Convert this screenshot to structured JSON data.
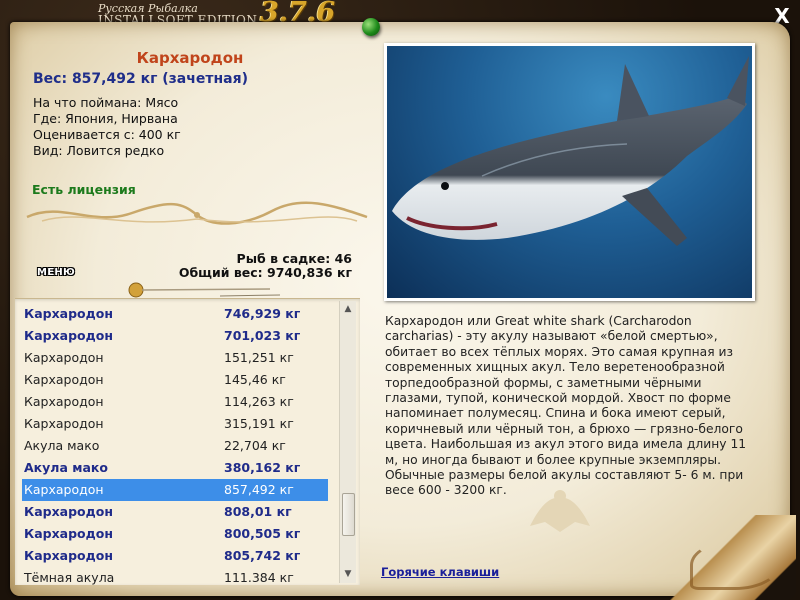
{
  "app": {
    "title_ru": "Русская Рыбалка",
    "title_en": "INSTALLSOFT EDITION",
    "version": "3.7.6",
    "close_glyph": "X"
  },
  "fish": {
    "name": "Кархародон",
    "weight": "Вес: 857,492 кг (зачетная)",
    "bait": "На что поймана: Мясо",
    "location": "Где: Япония, Нирвана",
    "valued_from": "Оценивается с: 400 кг",
    "kind": "Вид: Ловится редко",
    "license": "Есть лицензия"
  },
  "stats": {
    "count": "Рыб в садке: 46",
    "total": "Общий вес: 9740,836 кг"
  },
  "menu_label": "МЕНЮ",
  "catch_list": [
    {
      "name": "Кархародон",
      "weight": "746,929 кг",
      "bold": true,
      "selected": false
    },
    {
      "name": "Кархародон",
      "weight": "701,023 кг",
      "bold": true,
      "selected": false
    },
    {
      "name": "Кархародон",
      "weight": "151,251 кг",
      "bold": false,
      "selected": false
    },
    {
      "name": "Кархародон",
      "weight": "145,46 кг",
      "bold": false,
      "selected": false
    },
    {
      "name": "Кархародон",
      "weight": "114,263 кг",
      "bold": false,
      "selected": false
    },
    {
      "name": "Кархародон",
      "weight": "315,191 кг",
      "bold": false,
      "selected": false
    },
    {
      "name": "Акула мако",
      "weight": "22,704 кг",
      "bold": false,
      "selected": false
    },
    {
      "name": "Акула мако",
      "weight": "380,162 кг",
      "bold": true,
      "selected": false
    },
    {
      "name": "Кархародон",
      "weight": "857,492 кг",
      "bold": true,
      "selected": true
    },
    {
      "name": "Кархародон",
      "weight": "808,01 кг",
      "bold": true,
      "selected": false
    },
    {
      "name": "Кархародон",
      "weight": "800,505 кг",
      "bold": true,
      "selected": false
    },
    {
      "name": "Кархародон",
      "weight": "805,742 кг",
      "bold": true,
      "selected": false
    },
    {
      "name": "Тёмная акула",
      "weight": "111.384 кг",
      "bold": false,
      "selected": false
    }
  ],
  "description": "Кархародон или Great white shark (Carcharodon carcharias) - эту акулу называют «белой смертью», обитает во всех тёплых морях. Это самая крупная из современных хищных акул. Тело веретенообразной торпедообразной формы, с заметными чёрными глазами, тупой, конической мордой. Хвост по форме напоминает полумесяц. Спина и бока имеют серый, коричневый или чёрный тон, а брюхо — грязно-белого цвета. Наибольшая из акул этого вида имела длину 11 м, но иногда бывают и более крупные экземпляры. Обычные размеры белой акулы составляют 5- 6 м. при весе 600 - 3200 кг.",
  "hotkeys_link": "Горячие клавиши",
  "colors": {
    "fish_name": "#c0441b",
    "weight": "#1f2e8a",
    "license": "#1c7a1c",
    "selection": "#3d8ee8",
    "link": "#1a1f9a"
  },
  "icons": {
    "pin": "green-pin-icon",
    "close": "close-icon",
    "scroll_up": "arrow-up-icon",
    "scroll_down": "arrow-down-icon"
  }
}
